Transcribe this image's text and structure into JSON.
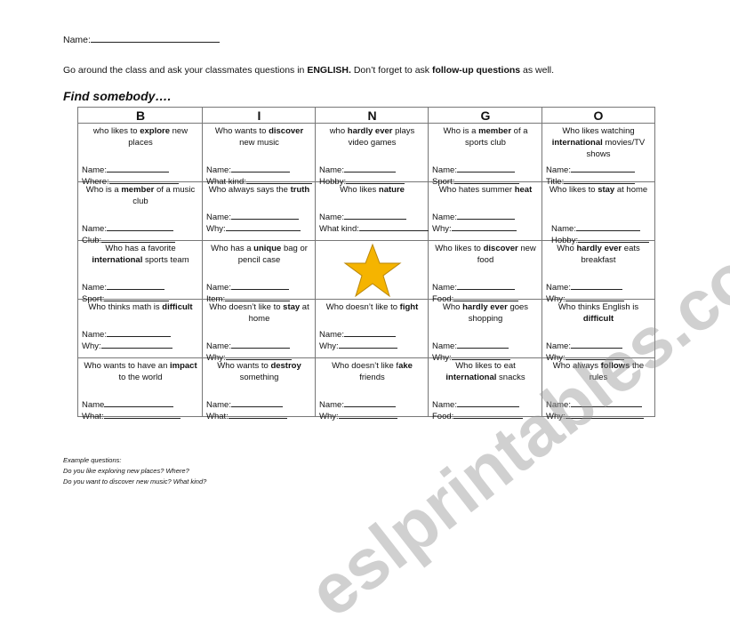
{
  "name_label": "Name:",
  "instructions": [
    {
      "t": "Go around the class and ask your classmates questions in ",
      "b": false
    },
    {
      "t": "ENGLISH.",
      "b": true
    },
    {
      "t": " Don’t forget to ask ",
      "b": false
    },
    {
      "t": "follow-up questions",
      "b": true
    },
    {
      "t": " as well.",
      "b": false
    }
  ],
  "heading": "Find somebody….",
  "headers": [
    "B",
    "I",
    "N",
    "G",
    "O"
  ],
  "star_color": "#F5B400",
  "rows": [
    [
      {
        "q": [
          [
            "who likes to ",
            0
          ],
          [
            "explore",
            1
          ],
          [
            " new places",
            0
          ]
        ],
        "fields": [
          "Name:",
          "Where:"
        ]
      },
      {
        "q": [
          [
            "Who wants to ",
            0
          ],
          [
            "discover",
            1
          ],
          [
            " new music",
            0
          ]
        ],
        "fields": [
          "Name:",
          "What kind:"
        ]
      },
      {
        "q": [
          [
            "who ",
            0
          ],
          [
            "hardly ever",
            1
          ],
          [
            " plays video games",
            0
          ]
        ],
        "fields": [
          "Name:",
          "Hobby:"
        ]
      },
      {
        "q": [
          [
            "Who is a ",
            0
          ],
          [
            "member",
            1
          ],
          [
            " of a sports club",
            0
          ]
        ],
        "fields": [
          "Name:",
          "Sport:"
        ]
      },
      {
        "q": [
          [
            "Who likes watching ",
            0
          ],
          [
            "international",
            1
          ],
          [
            " movies/TV shows",
            0
          ]
        ],
        "fields": [
          "Name:",
          "Title:"
        ]
      }
    ],
    [
      {
        "q": [
          [
            "Who is a ",
            0
          ],
          [
            "member",
            1
          ],
          [
            " of a music club",
            0
          ]
        ],
        "fields": [
          "Name:",
          "Club:"
        ]
      },
      {
        "q": [
          [
            "Who always says the ",
            0
          ],
          [
            "truth",
            1
          ]
        ],
        "fields": [
          "Name:",
          "Why:"
        ]
      },
      {
        "q": [
          [
            "Who likes ",
            0
          ],
          [
            "nature",
            1
          ]
        ],
        "fields": [
          "Name:",
          "What kind:"
        ]
      },
      {
        "q": [
          [
            "Who hates summer ",
            0
          ],
          [
            "heat",
            1
          ]
        ],
        "fields": [
          "Name:",
          "Why:"
        ]
      },
      {
        "q": [
          [
            "Who likes to ",
            0
          ],
          [
            "stay",
            1
          ],
          [
            " at home",
            0
          ]
        ],
        "fields": [
          "Name:",
          "Hobby:"
        ]
      }
    ],
    [
      {
        "q": [
          [
            "Who has a favorite ",
            0
          ],
          [
            "international",
            1
          ],
          [
            " sports team",
            0
          ]
        ],
        "fields": [
          "Name:",
          "Sport:"
        ]
      },
      {
        "q": [
          [
            "Who has a ",
            0
          ],
          [
            "unique",
            1
          ],
          [
            " bag or pencil case",
            0
          ]
        ],
        "fields": [
          "Name:",
          "Item:"
        ]
      },
      {
        "star": true,
        "q": [],
        "fields": []
      },
      {
        "q": [
          [
            "Who likes to ",
            0
          ],
          [
            "discover",
            1
          ],
          [
            " new food",
            0
          ]
        ],
        "fields": [
          "Name:",
          "Food:"
        ]
      },
      {
        "q": [
          [
            "Who ",
            0
          ],
          [
            "hardly ever",
            1
          ],
          [
            " eats breakfast",
            0
          ]
        ],
        "fields": [
          "Name:",
          "Why:"
        ]
      }
    ],
    [
      {
        "q": [
          [
            "Who thinks math is ",
            0
          ],
          [
            "difficult",
            1
          ]
        ],
        "fields": [
          "Name:",
          "Why:"
        ]
      },
      {
        "q": [
          [
            "Who doesn’t like to ",
            0
          ],
          [
            "stay",
            1
          ],
          [
            " at home",
            0
          ]
        ],
        "fields": [
          "Name:",
          "Why:"
        ]
      },
      {
        "q": [
          [
            "Who doesn’t like to ",
            0
          ],
          [
            "fight",
            1
          ]
        ],
        "fields": [
          "Name:",
          "Why:"
        ]
      },
      {
        "q": [
          [
            "Who ",
            0
          ],
          [
            "hardly ever",
            1
          ],
          [
            " goes shopping",
            0
          ]
        ],
        "fields": [
          "Name:",
          "Why:"
        ]
      },
      {
        "q": [
          [
            "Who thinks English is ",
            0
          ],
          [
            "difficult",
            1
          ]
        ],
        "fields": [
          "Name:",
          "Why:"
        ]
      }
    ],
    [
      {
        "q": [
          [
            "Who wants to have an ",
            0
          ],
          [
            "impact",
            1
          ],
          [
            " to the world",
            0
          ]
        ],
        "fields": [
          "Name",
          "What:"
        ]
      },
      {
        "q": [
          [
            "Who wants to ",
            0
          ],
          [
            "destroy",
            1
          ],
          [
            " something",
            0
          ]
        ],
        "fields": [
          "Name:",
          "What:"
        ]
      },
      {
        "q": [
          [
            "Who doesn’t like f",
            0
          ],
          [
            "ake",
            1
          ],
          [
            " friends",
            0
          ]
        ],
        "fields": [
          "Name:",
          "Why:"
        ]
      },
      {
        "q": [
          [
            "Who likes to eat ",
            0
          ],
          [
            "international",
            1
          ],
          [
            " snacks",
            0
          ]
        ],
        "fields": [
          "Name:",
          "Food:"
        ]
      },
      {
        "q": [
          [
            "Who always ",
            0
          ],
          [
            "follows",
            1
          ],
          [
            " the rules",
            0
          ]
        ],
        "fields": [
          "Name:",
          "Why:"
        ]
      }
    ]
  ],
  "examples": [
    "Example questions:",
    "Do you like exploring new places? Where?",
    "Do you want to discover new music? What kind?"
  ],
  "watermark": "eslprintables.com"
}
